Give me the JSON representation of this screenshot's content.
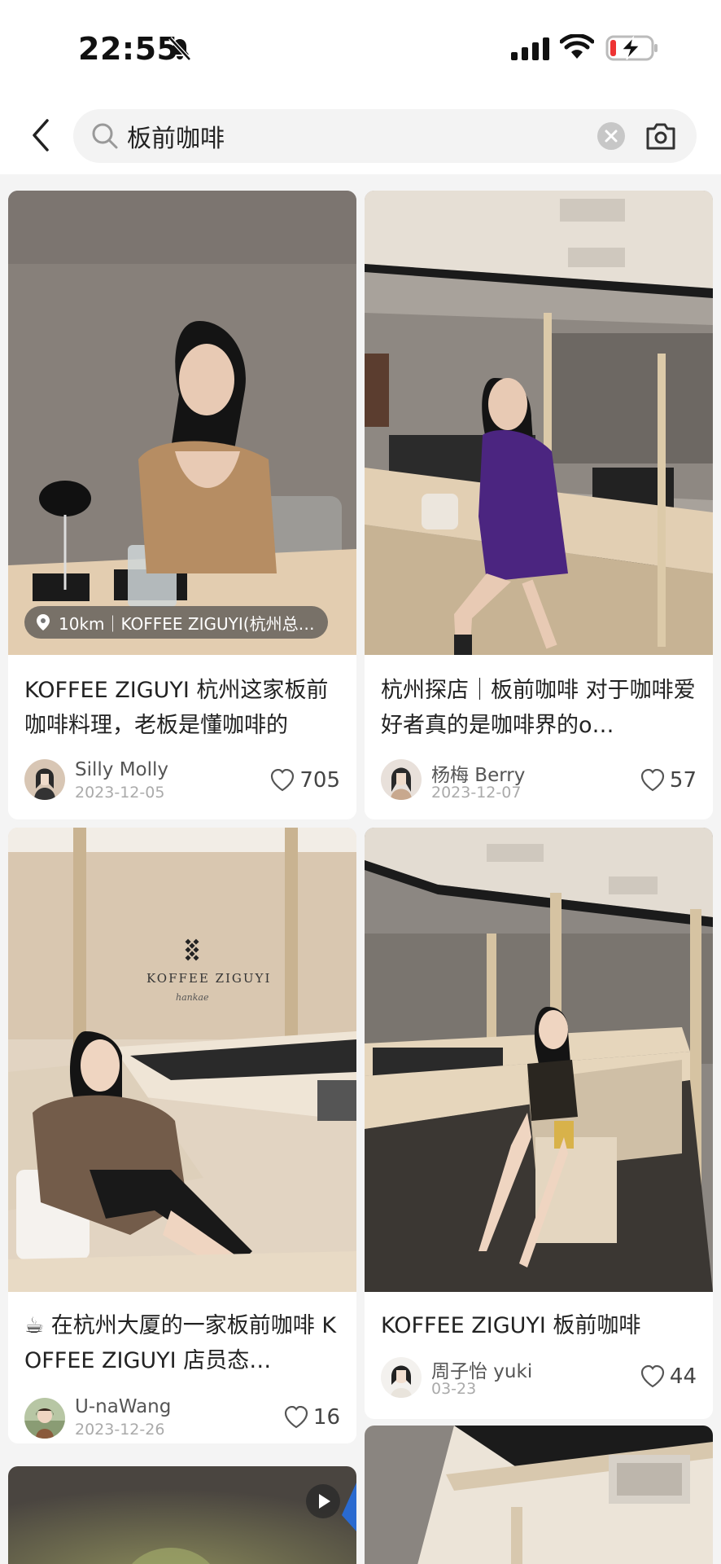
{
  "status_bar": {
    "time": "22:55"
  },
  "search": {
    "query": "板前咖啡",
    "icons": [
      "back-icon",
      "search-icon",
      "clear-icon",
      "camera-icon"
    ]
  },
  "posts": [
    {
      "title": "KOFFEE ZIGUYI 杭州这家板前咖啡料理，老板是懂咖啡的",
      "author": "Silly Molly",
      "date": "2023-12-05",
      "likes": "705",
      "location": "10km｜KOFFEE ZIGUYI(杭州总…"
    },
    {
      "title": "杭州探店｜板前咖啡 对于咖啡爱好者真的是咖啡界的o…",
      "author": "杨梅 Berry",
      "date": "2023-12-07",
      "likes": "57"
    },
    {
      "title": "☕ 在杭州大厦的一家板前咖啡 KOFFEE ZIGUYI 店员态…",
      "author": "U-naWang",
      "date": "2023-12-26",
      "likes": "16",
      "image_text": "KOFFEE ZIGUYI",
      "image_subtext": "hankae"
    },
    {
      "title": "KOFFEE ZIGUYI 板前咖啡",
      "author": "周子怡 yuki",
      "date": "03-23",
      "likes": "44"
    },
    {
      "type": "video"
    },
    {}
  ],
  "colors": {
    "background": "#f4f4f4",
    "card": "#ffffff",
    "battery_red": "#ee3333"
  }
}
